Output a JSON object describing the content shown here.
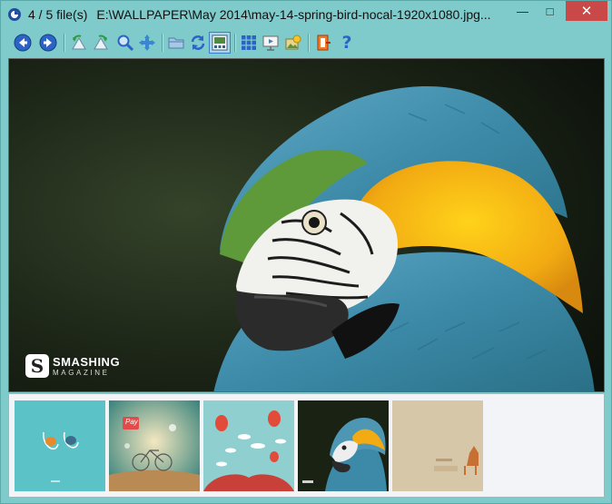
{
  "window": {
    "file_counter": "4 / 5 file(s)",
    "file_path": "E:\\WALLPAPER\\May 2014\\may-14-spring-bird-nocal-1920x1080.jpg...",
    "minimize_glyph": "—",
    "maximize_glyph": "□",
    "close_glyph": "✕"
  },
  "toolbar": {
    "buttons": [
      {
        "icon": "back-arrow-icon"
      },
      {
        "icon": "forward-arrow-icon"
      },
      {
        "icon": "rotate-left-icon"
      },
      {
        "icon": "rotate-right-icon"
      },
      {
        "icon": "zoom-icon"
      },
      {
        "icon": "fit-move-icon"
      },
      {
        "icon": "open-folder-icon"
      },
      {
        "icon": "refresh-icon"
      },
      {
        "icon": "filmstrip-view-icon",
        "active": true
      },
      {
        "icon": "thumbnail-grid-icon"
      },
      {
        "icon": "slideshow-icon"
      },
      {
        "icon": "set-wallpaper-icon"
      },
      {
        "icon": "exit-icon"
      },
      {
        "icon": "help-icon"
      },
      {
        "help_glyph": "?"
      }
    ]
  },
  "main_image": {
    "subject": "blue-and-yellow macaw",
    "watermark_line1": "SMASHING",
    "watermark_line2": "MAGAZINE",
    "watermark_glyph": "S"
  },
  "filmstrip": {
    "thumbnails": [
      {
        "name": "thumbnail-1",
        "selected": false
      },
      {
        "name": "thumbnail-2",
        "label": "Pay",
        "selected": false
      },
      {
        "name": "thumbnail-3",
        "selected": false
      },
      {
        "name": "thumbnail-4",
        "selected": true
      },
      {
        "name": "thumbnail-5",
        "selected": false
      }
    ]
  },
  "colors": {
    "window_bg": "#7fcaca",
    "close_button": "#c94848",
    "accent_blue": "#2b64c4"
  }
}
